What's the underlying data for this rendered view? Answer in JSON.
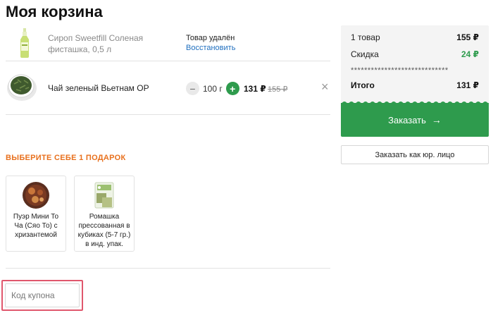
{
  "page_title": "Моя корзина",
  "items": [
    {
      "name": "Сироп Sweetfill Соленая фисташка, 0,5 л",
      "status_text": "Товар удалён",
      "restore_label": "Восстановить",
      "image_icon": "syrup-bottle-icon"
    },
    {
      "name": "Чай зеленый Вьетнам OP",
      "quantity": "100 г",
      "minus_label": "−",
      "plus_label": "+",
      "price": "131 ₽",
      "old_price": "155 ₽",
      "remove_label": "×",
      "image_icon": "tea-cup-icon"
    }
  ],
  "gifts": {
    "title": "ВЫБЕРИТЕ СЕБЕ 1 ПОДАРОК",
    "items": [
      {
        "name": "Пуэр Мини То Ча (Сяо То) с хризантемой",
        "image_icon": "puer-tea-icon"
      },
      {
        "name": "Ромашка прессованная в кубиках (5-7 гр.) в инд. упак.",
        "image_icon": "chamomile-pack-icon"
      }
    ]
  },
  "coupon": {
    "placeholder": "Код купона"
  },
  "summary": {
    "items_label": "1 товар",
    "items_value": "155 ₽",
    "discount_label": "Скидка",
    "discount_value": "24 ₽",
    "separator": "*****************************",
    "total_label": "Итого",
    "total_value": "131 ₽",
    "order_label": "Заказать",
    "order_arrow": "→",
    "legal_label": "Заказать как юр. лицо"
  },
  "colors": {
    "accent_green": "#2e9b4d",
    "gift_title_orange": "#e8701d",
    "link_blue": "#1f6fbf",
    "highlight_red": "#e0576d"
  }
}
